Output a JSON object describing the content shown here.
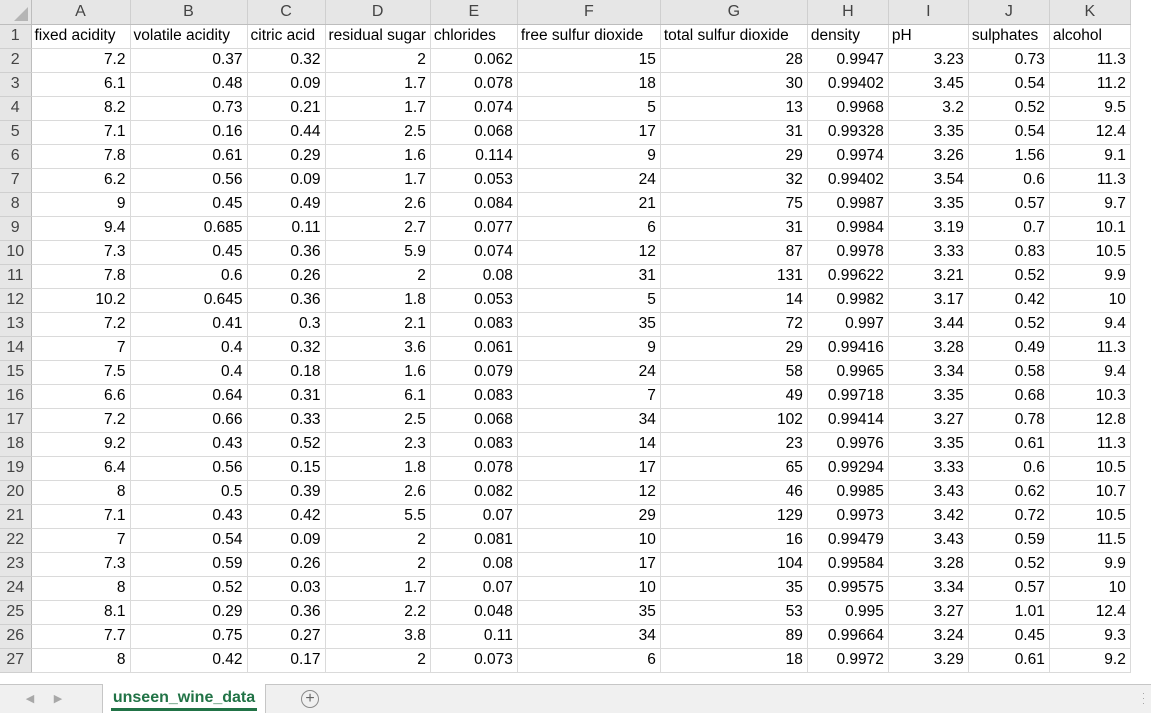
{
  "sheet": {
    "column_letters": [
      "A",
      "B",
      "C",
      "D",
      "E",
      "F",
      "G",
      "H",
      "I",
      "J",
      "K"
    ],
    "headers": [
      "fixed acidity",
      "volatile acidity",
      "citric acid",
      "residual sugar",
      "chlorides",
      "free sulfur dioxide",
      "total sulfur dioxide",
      "density",
      "pH",
      "sulphates",
      "alcohol"
    ],
    "rows": [
      [
        "7.2",
        "0.37",
        "0.32",
        "2",
        "0.062",
        "15",
        "28",
        "0.9947",
        "3.23",
        "0.73",
        "11.3"
      ],
      [
        "6.1",
        "0.48",
        "0.09",
        "1.7",
        "0.078",
        "18",
        "30",
        "0.99402",
        "3.45",
        "0.54",
        "11.2"
      ],
      [
        "8.2",
        "0.73",
        "0.21",
        "1.7",
        "0.074",
        "5",
        "13",
        "0.9968",
        "3.2",
        "0.52",
        "9.5"
      ],
      [
        "7.1",
        "0.16",
        "0.44",
        "2.5",
        "0.068",
        "17",
        "31",
        "0.99328",
        "3.35",
        "0.54",
        "12.4"
      ],
      [
        "7.8",
        "0.61",
        "0.29",
        "1.6",
        "0.114",
        "9",
        "29",
        "0.9974",
        "3.26",
        "1.56",
        "9.1"
      ],
      [
        "6.2",
        "0.56",
        "0.09",
        "1.7",
        "0.053",
        "24",
        "32",
        "0.99402",
        "3.54",
        "0.6",
        "11.3"
      ],
      [
        "9",
        "0.45",
        "0.49",
        "2.6",
        "0.084",
        "21",
        "75",
        "0.9987",
        "3.35",
        "0.57",
        "9.7"
      ],
      [
        "9.4",
        "0.685",
        "0.11",
        "2.7",
        "0.077",
        "6",
        "31",
        "0.9984",
        "3.19",
        "0.7",
        "10.1"
      ],
      [
        "7.3",
        "0.45",
        "0.36",
        "5.9",
        "0.074",
        "12",
        "87",
        "0.9978",
        "3.33",
        "0.83",
        "10.5"
      ],
      [
        "7.8",
        "0.6",
        "0.26",
        "2",
        "0.08",
        "31",
        "131",
        "0.99622",
        "3.21",
        "0.52",
        "9.9"
      ],
      [
        "10.2",
        "0.645",
        "0.36",
        "1.8",
        "0.053",
        "5",
        "14",
        "0.9982",
        "3.17",
        "0.42",
        "10"
      ],
      [
        "7.2",
        "0.41",
        "0.3",
        "2.1",
        "0.083",
        "35",
        "72",
        "0.997",
        "3.44",
        "0.52",
        "9.4"
      ],
      [
        "7",
        "0.4",
        "0.32",
        "3.6",
        "0.061",
        "9",
        "29",
        "0.99416",
        "3.28",
        "0.49",
        "11.3"
      ],
      [
        "7.5",
        "0.4",
        "0.18",
        "1.6",
        "0.079",
        "24",
        "58",
        "0.9965",
        "3.34",
        "0.58",
        "9.4"
      ],
      [
        "6.6",
        "0.64",
        "0.31",
        "6.1",
        "0.083",
        "7",
        "49",
        "0.99718",
        "3.35",
        "0.68",
        "10.3"
      ],
      [
        "7.2",
        "0.66",
        "0.33",
        "2.5",
        "0.068",
        "34",
        "102",
        "0.99414",
        "3.27",
        "0.78",
        "12.8"
      ],
      [
        "9.2",
        "0.43",
        "0.52",
        "2.3",
        "0.083",
        "14",
        "23",
        "0.9976",
        "3.35",
        "0.61",
        "11.3"
      ],
      [
        "6.4",
        "0.56",
        "0.15",
        "1.8",
        "0.078",
        "17",
        "65",
        "0.99294",
        "3.33",
        "0.6",
        "10.5"
      ],
      [
        "8",
        "0.5",
        "0.39",
        "2.6",
        "0.082",
        "12",
        "46",
        "0.9985",
        "3.43",
        "0.62",
        "10.7"
      ],
      [
        "7.1",
        "0.43",
        "0.42",
        "5.5",
        "0.07",
        "29",
        "129",
        "0.9973",
        "3.42",
        "0.72",
        "10.5"
      ],
      [
        "7",
        "0.54",
        "0.09",
        "2",
        "0.081",
        "10",
        "16",
        "0.99479",
        "3.43",
        "0.59",
        "11.5"
      ],
      [
        "7.3",
        "0.59",
        "0.26",
        "2",
        "0.08",
        "17",
        "104",
        "0.99584",
        "3.28",
        "0.52",
        "9.9"
      ],
      [
        "8",
        "0.52",
        "0.03",
        "1.7",
        "0.07",
        "10",
        "35",
        "0.99575",
        "3.34",
        "0.57",
        "10"
      ],
      [
        "8.1",
        "0.29",
        "0.36",
        "2.2",
        "0.048",
        "35",
        "53",
        "0.995",
        "3.27",
        "1.01",
        "12.4"
      ],
      [
        "7.7",
        "0.75",
        "0.27",
        "3.8",
        "0.11",
        "34",
        "89",
        "0.99664",
        "3.24",
        "0.45",
        "9.3"
      ],
      [
        "8",
        "0.42",
        "0.17",
        "2",
        "0.073",
        "6",
        "18",
        "0.9972",
        "3.29",
        "0.61",
        "9.2"
      ]
    ]
  },
  "tabs": {
    "active_sheet": "unseen_wine_data",
    "add_sheet_glyph": "+",
    "nav_prev_icon": "◀",
    "nav_next_icon": "▶"
  },
  "colors": {
    "accent": "#217346",
    "header_bg": "#e6e6e6",
    "gridline": "#dadada"
  }
}
